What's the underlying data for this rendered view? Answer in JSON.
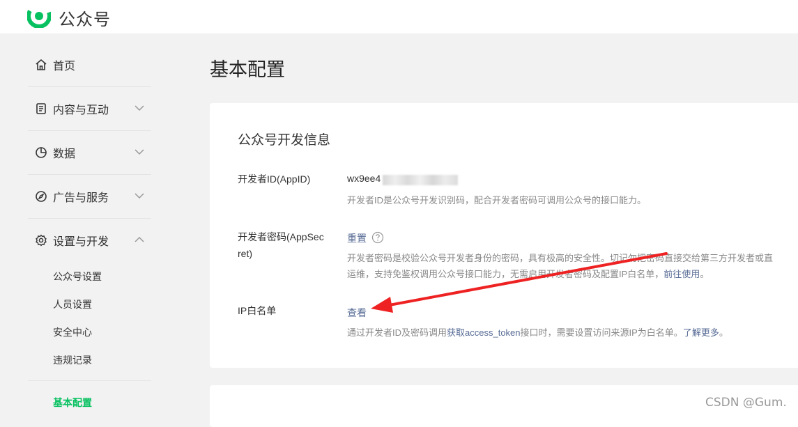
{
  "app": {
    "title": "公众号",
    "brand_color": "#07c160"
  },
  "sidebar": {
    "items": [
      {
        "label": "首页",
        "icon": "home-icon"
      },
      {
        "label": "内容与互动",
        "icon": "document-icon"
      },
      {
        "label": "数据",
        "icon": "pie-chart-icon"
      },
      {
        "label": "广告与服务",
        "icon": "compass-icon"
      },
      {
        "label": "设置与开发",
        "icon": "gear-icon"
      }
    ],
    "sub_items": [
      {
        "label": "公众号设置"
      },
      {
        "label": "人员设置"
      },
      {
        "label": "安全中心"
      },
      {
        "label": "违规记录"
      },
      {
        "label": "基本配置"
      }
    ]
  },
  "main": {
    "page_title": "基本配置",
    "dev_info": {
      "title": "公众号开发信息",
      "appid": {
        "label": "开发者ID(AppID)",
        "value": "wx9ee4",
        "desc": "开发者ID是公众号开发识别码，配合开发者密码可调用公众号的接口能力。"
      },
      "appsecret": {
        "label_line1": "开发者密码(AppSec",
        "label_line2": "ret)",
        "reset": "重置",
        "desc_line1": "开发者密码是校验公众号开发者身份的密码，具有极高的安全性。切记勿把密码直接交给第三方开发者或直",
        "desc_line2_a": "运维，支持免鉴权调用公众号接口能力，无需启用开发者密码及配置IP白名单，",
        "desc_line2_link": "前往使用",
        "desc_line2_end": "。"
      },
      "ip_whitelist": {
        "label": "IP白名单",
        "view": "查看",
        "desc_a": "通过开发者ID及密码调用",
        "desc_link1": "获取access_token",
        "desc_b": "接口时，需要设置访问来源IP为白名单。",
        "desc_link2": "了解更多",
        "desc_end": "。"
      }
    }
  },
  "annotation": {
    "arrow_color": "#ee2222"
  },
  "watermark": "CSDN @Gum."
}
